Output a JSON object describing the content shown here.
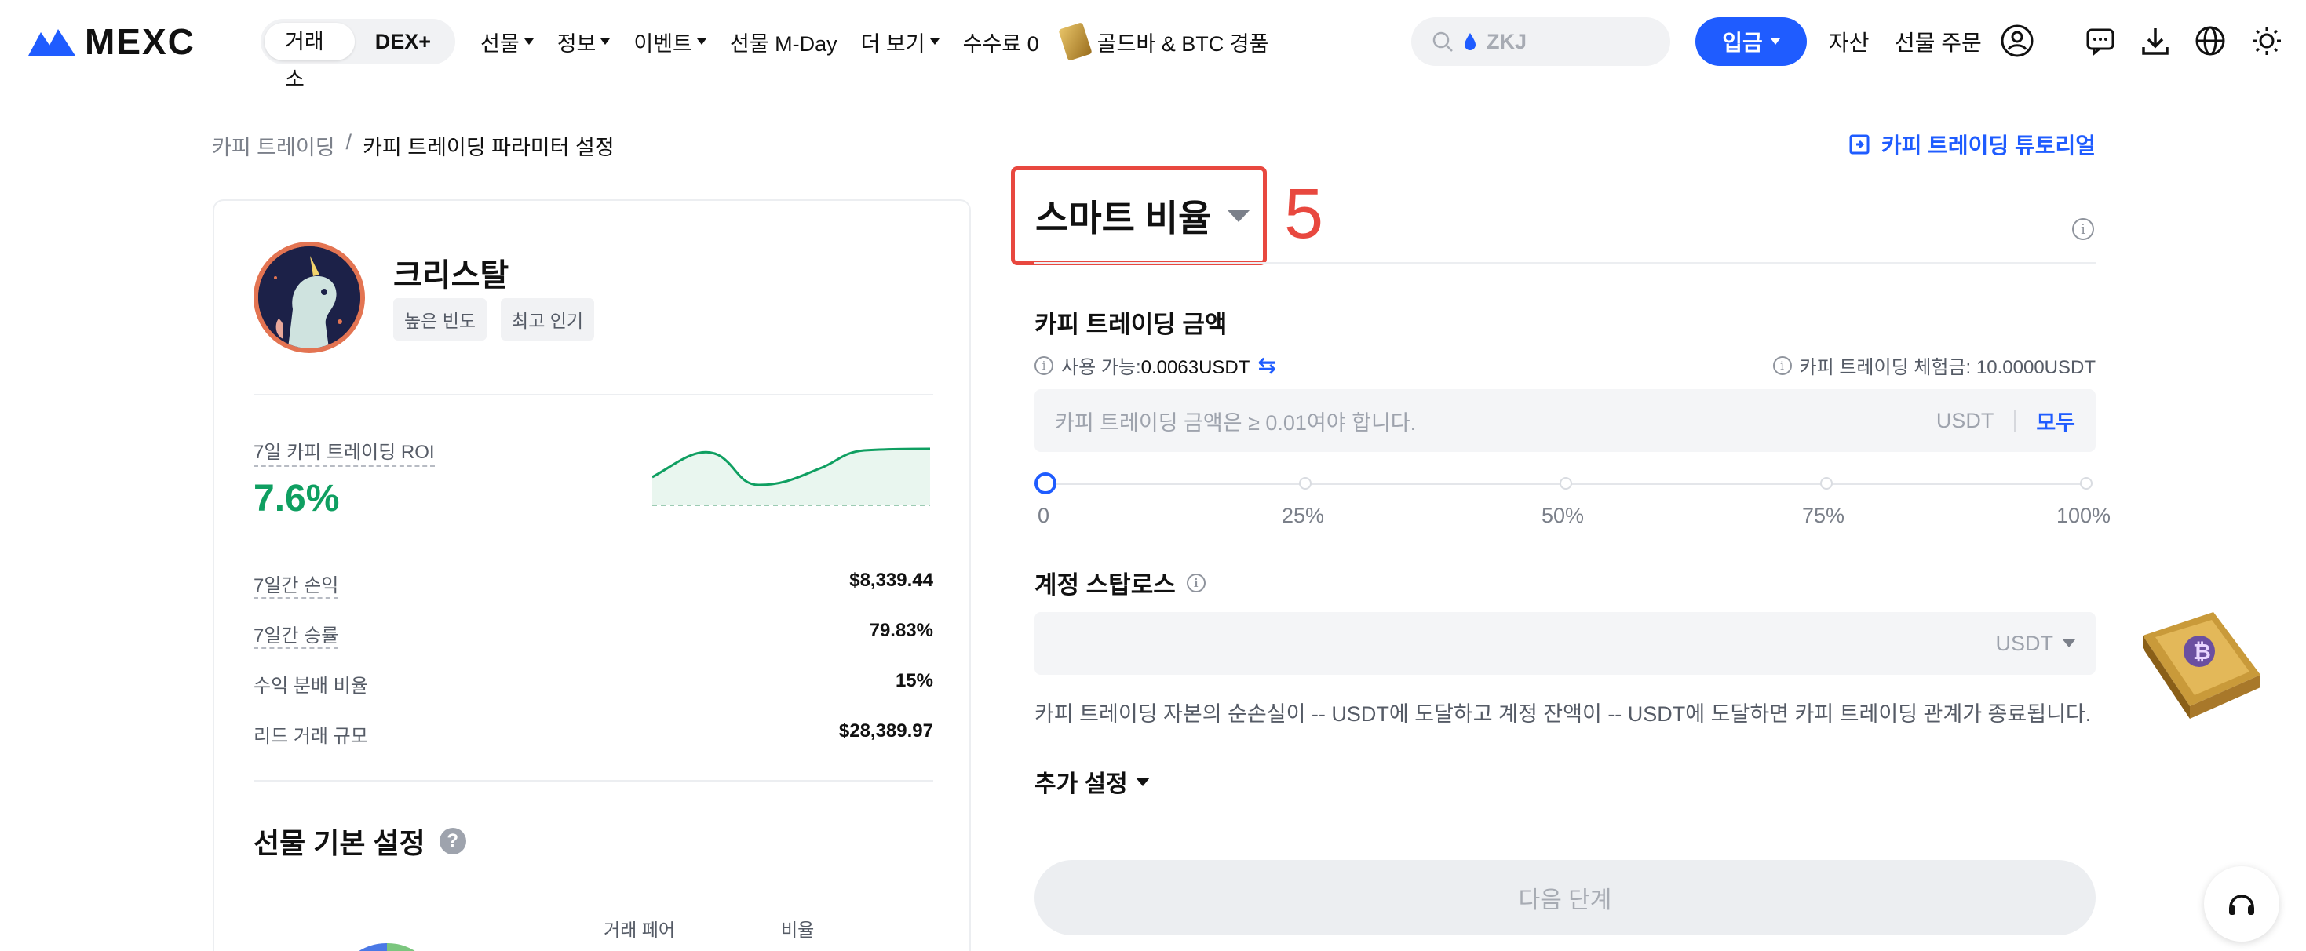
{
  "brand": {
    "logo_text": "MEXC"
  },
  "header": {
    "segment": [
      "거래소",
      "DEX+"
    ],
    "nav": [
      {
        "label": "선물",
        "dropdown": true
      },
      {
        "label": "정보",
        "dropdown": true
      },
      {
        "label": "이벤트",
        "dropdown": true
      },
      {
        "label": "선물 M-Day",
        "dropdown": false
      },
      {
        "label": "더 보기",
        "dropdown": true
      },
      {
        "label": "수수료 0",
        "dropdown": false
      },
      {
        "label": "골드바 & BTC 경품",
        "dropdown": false,
        "icon": "gold-bar-icon"
      }
    ],
    "search_placeholder": "ZKJ",
    "deposit": "입금",
    "assets": "자산",
    "futures_orders": "선물 주문",
    "icons": [
      "user-icon",
      "message-icon",
      "download-icon",
      "globe-icon",
      "theme-icon"
    ],
    "accent": "#1f5cff"
  },
  "breadcrumb": {
    "parent": "카피 트레이딩",
    "separator": "/",
    "current": "카피 트레이딩 파라미터 설정"
  },
  "tutorial_link": "카피 트레이딩 튜토리얼",
  "trader": {
    "name": "크리스탈",
    "tags": [
      "높은 빈도",
      "최고 인기"
    ],
    "roi_label": "7일 카피 트레이딩 ROI",
    "roi_value": "7.6%",
    "roi_color": "#0f9f61",
    "stats": [
      {
        "label": "7일간 손익",
        "value": "$8,339.44",
        "dashed": true
      },
      {
        "label": "7일간 승률",
        "value": "79.83%",
        "dashed": true
      },
      {
        "label": "수익 분배 비율",
        "value": "15%",
        "dashed": false
      },
      {
        "label": "리드 거래 규모",
        "value": "$28,389.97",
        "dashed": false
      }
    ],
    "futures_settings_title": "선물 기본 설정",
    "table_headers": [
      "거래 페어",
      "비율"
    ]
  },
  "form": {
    "mode": "스마트 비율",
    "step_marker": "5",
    "amount_title": "카피 트레이딩 금액",
    "available_label": "사용 가능:",
    "available_value": "0.0063USDT",
    "trial_label": "카피 트레이딩 체험금:",
    "trial_value": "10.0000USDT",
    "amount_placeholder": "카피 트레이딩 금액은 ≥ 0.01여야 합니다.",
    "amount_unit": "USDT",
    "all_label": "모두",
    "slider_value_percent": 0,
    "slider_labels": [
      "0",
      "25%",
      "50%",
      "75%",
      "100%"
    ],
    "stoploss_title": "계정 스탑로스",
    "stoploss_unit": "USDT",
    "stoploss_note": "카피 트레이딩 자본의 순손실이 -- USDT에 도달하고 계정 잔액이 -- USDT에 도달하면 카피 트레이딩 관계가 종료됩니다.",
    "more_settings": "추가 설정",
    "next_button": "다음 단계",
    "highlight_color": "#e8483f"
  }
}
